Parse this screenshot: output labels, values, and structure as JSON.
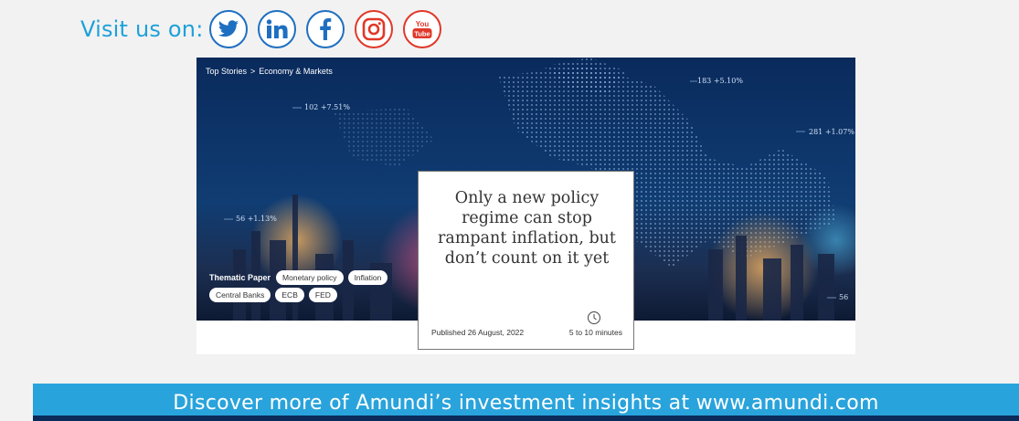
{
  "social": {
    "label": "Visit us on:",
    "icons": [
      "twitter-icon",
      "linkedin-icon",
      "facebook-icon",
      "instagram-icon",
      "youtube-icon"
    ],
    "youtube_text_1": "You",
    "youtube_text_2": "Tube"
  },
  "hero": {
    "breadcrumb": {
      "item1": "Top Stories",
      "separator": ">",
      "item2": "Economy & Markets"
    },
    "map_labels": [
      "183 +5.10%",
      "102 +7.51%",
      "281 +1.07%",
      "56 +1.13%",
      "56"
    ],
    "tag_label": "Thematic Paper",
    "tags": [
      "Monetary policy",
      "Inflation",
      "Central Banks",
      "ECB",
      "FED"
    ]
  },
  "card": {
    "title": "Only a new policy regime can stop rampant inflation, but don’t count on it yet",
    "published": "Published 26 August, 2022",
    "read_time": "5 to 10 minutes"
  },
  "footer": {
    "text": "Discover more of Amundi’s investment insights at www.amundi.com"
  },
  "colors": {
    "brand_blue": "#29a3dc",
    "dark_navy": "#0b2c5a",
    "social_blue": "#1e6fc1",
    "social_red": "#e0382a"
  }
}
